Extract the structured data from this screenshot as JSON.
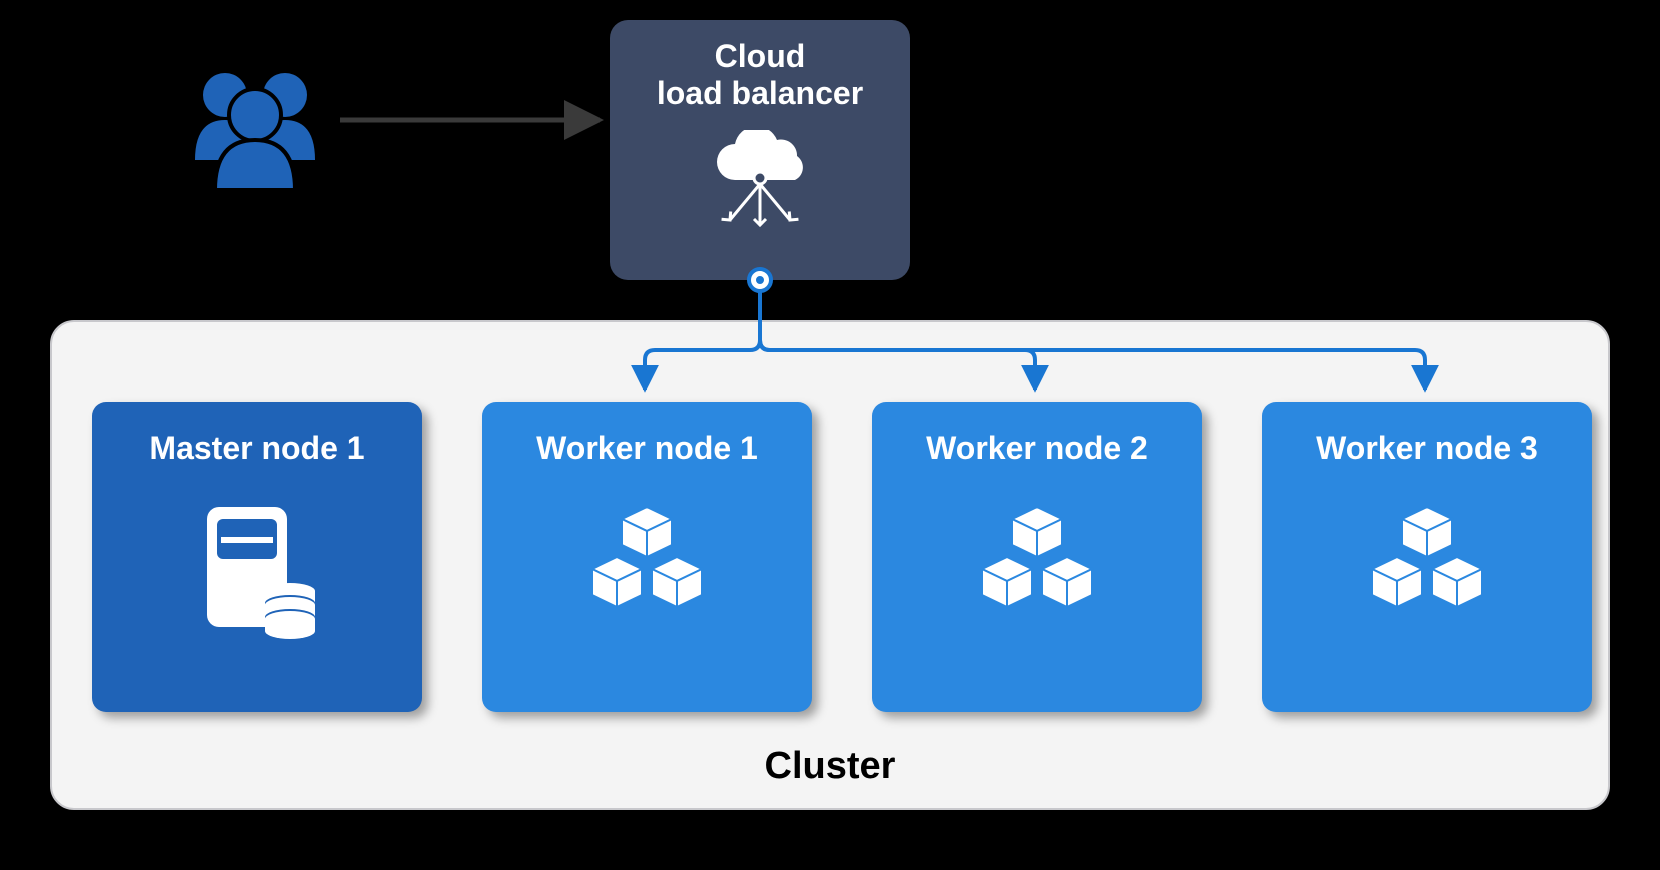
{
  "loadBalancer": {
    "line1": "Cloud",
    "line2": "load balancer"
  },
  "cluster": {
    "label": "Cluster"
  },
  "nodes": {
    "master": {
      "title": "Master node 1"
    },
    "workers": [
      {
        "title": "Worker node 1"
      },
      {
        "title": "Worker node 2"
      },
      {
        "title": "Worker node 3"
      }
    ]
  },
  "colors": {
    "lbBox": "#3d4a66",
    "masterNode": "#1f63b7",
    "workerNode": "#2b88e0",
    "clusterBg": "#f4f4f4",
    "arrowBlue": "#1976d2",
    "arrowDark": "#3a3a3a"
  }
}
